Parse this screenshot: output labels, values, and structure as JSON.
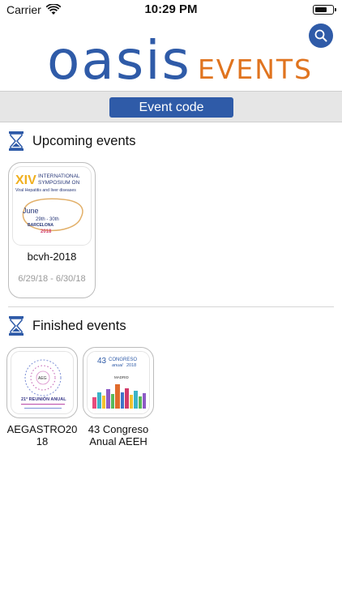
{
  "status_bar": {
    "carrier": "Carrier",
    "time": "10:29 PM",
    "battery_level_percent": 70
  },
  "header": {
    "logo_main": "oasis",
    "logo_sub": "EVENTS",
    "brand_color": "#2f5ba8",
    "accent_color": "#e0741f",
    "search_icon": "search-icon"
  },
  "event_code": {
    "button_label": "Event code"
  },
  "upcoming": {
    "title": "Upcoming events",
    "icon": "hourglass-icon",
    "events": [
      {
        "name": "bcvh-2018",
        "dates": "6/29/18 - 6/30/18",
        "poster": {
          "numeral": "XIV",
          "line1": "INTERNATIONAL",
          "line2": "SYMPOSIUM ON",
          "line3": "Viral Hepatitis and liver diseases",
          "month": "June",
          "days": "29th - 30th",
          "city": "BARCELONA",
          "year": "2018"
        }
      }
    ]
  },
  "finished": {
    "title": "Finished events",
    "icon": "hourglass-icon",
    "events": [
      {
        "name": "AEGASTRO20\n18",
        "poster": {
          "center": "AEG",
          "headline": "21ª REUNIÓN ANUAL"
        }
      },
      {
        "name": "43 Congreso\nAnual AEEH",
        "poster": {
          "number": "43",
          "word": "CONGRESO",
          "subword": "anual",
          "year": "2018",
          "city": "MADRID"
        }
      }
    ]
  }
}
